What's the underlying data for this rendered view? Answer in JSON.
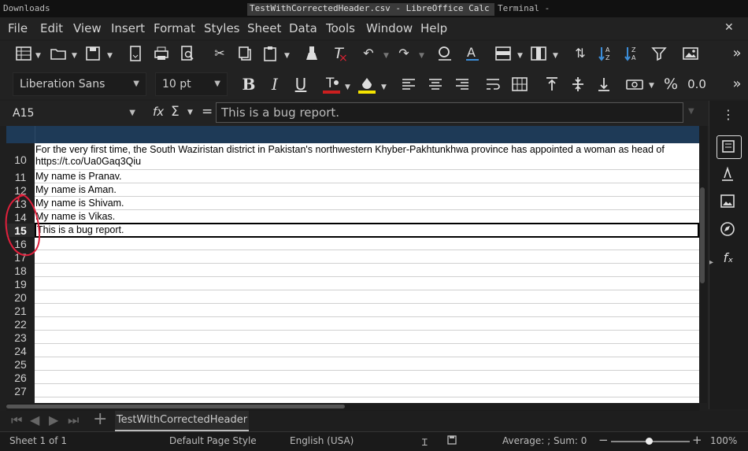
{
  "taskbar": {
    "left_label": "Downloads",
    "window_title": "TestWithCorrectedHeader.csv - LibreOffice Calc",
    "right_label": "Terminal -"
  },
  "menu": [
    "File",
    "Edit",
    "View",
    "Insert",
    "Format",
    "Styles",
    "Sheet",
    "Data",
    "Tools",
    "Window",
    "Help"
  ],
  "format_bar": {
    "font_name": "Liberation Sans",
    "font_size": "10 pt",
    "bold": "B",
    "italic": "I",
    "underline": "U",
    "percent": "%",
    "decimal": "0.0",
    "font_color": "#cc1f1f",
    "highlight_color": "#f5e400"
  },
  "formula_bar": {
    "name_box": "A15",
    "fx": "fx",
    "sigma": "Σ",
    "equals": "=",
    "content": "This is a bug report."
  },
  "rows": [
    {
      "num": "10",
      "text": "For the very first time, the South Waziristan district in Pakistan's northwestern Khyber-Pakhtunkhwa province has appointed a woman as head of",
      "text2": "https://t.co/Ua0Gaq3Qiu"
    },
    {
      "num": "11",
      "text": "My name is Pranav."
    },
    {
      "num": "12",
      "text": "My name is Aman."
    },
    {
      "num": "13",
      "text": "My name is Shivam."
    },
    {
      "num": "14",
      "text": "My name is Vikas."
    },
    {
      "num": "15",
      "text": "This is a bug report."
    },
    {
      "num": "16",
      "text": ""
    },
    {
      "num": "17",
      "text": ""
    },
    {
      "num": "18",
      "text": ""
    },
    {
      "num": "19",
      "text": ""
    },
    {
      "num": "20",
      "text": ""
    },
    {
      "num": "21",
      "text": ""
    },
    {
      "num": "22",
      "text": ""
    },
    {
      "num": "23",
      "text": ""
    },
    {
      "num": "24",
      "text": ""
    },
    {
      "num": "25",
      "text": ""
    },
    {
      "num": "26",
      "text": ""
    },
    {
      "num": "27",
      "text": ""
    }
  ],
  "sheet_tab": "TestWithCorrectedHeader",
  "status": {
    "sheet": "Sheet 1 of 1",
    "page_style": "Default Page Style",
    "language": "English (USA)",
    "summary": "Average: ; Sum: 0",
    "zoom_minus": "−",
    "zoom_plus": "+",
    "zoom": "100%"
  },
  "sidebar_icons": [
    "menu-dots-icon",
    "properties-icon",
    "styles-icon",
    "gallery-icon",
    "navigator-icon",
    "functions-icon"
  ],
  "annotation_color": "#e0203c"
}
